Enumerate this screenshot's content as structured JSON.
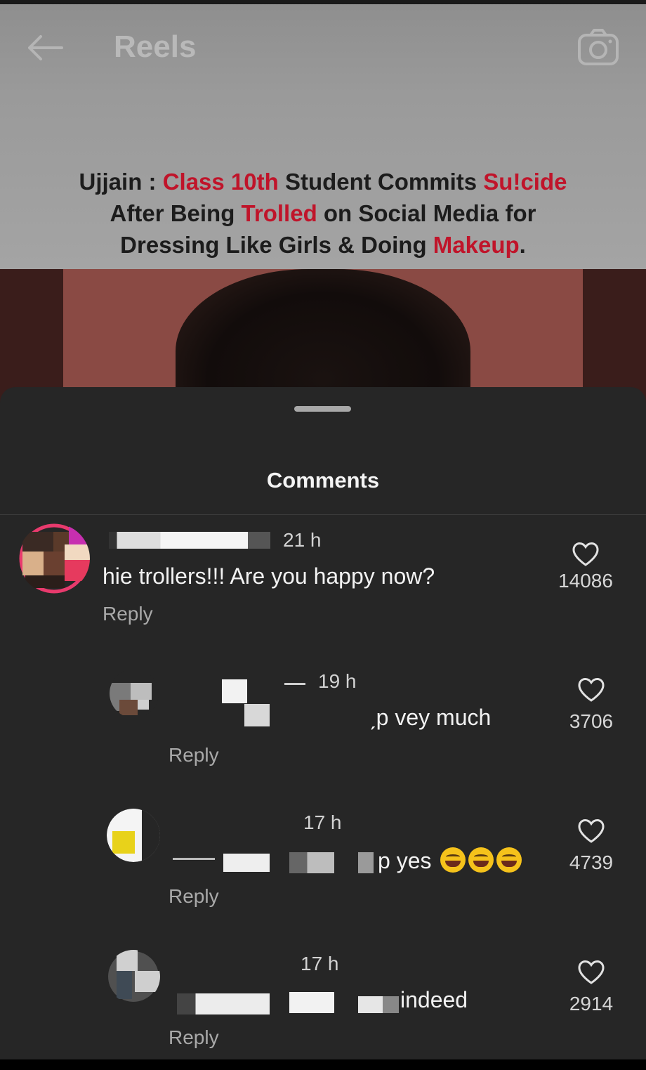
{
  "header": {
    "title": "Reels",
    "back_icon": "arrow-left-icon",
    "camera_icon": "camera-icon"
  },
  "headline": {
    "line1": [
      {
        "text": "Ujjain : ",
        "red": false
      },
      {
        "text": "Class 10th",
        "red": true
      },
      {
        "text": " Student Commits ",
        "red": false
      },
      {
        "text": "Su!cide",
        "red": true
      }
    ],
    "line2": [
      {
        "text": "After Being ",
        "red": false
      },
      {
        "text": "Trolled",
        "red": true
      },
      {
        "text": " on Social Media for",
        "red": false
      }
    ],
    "line3": [
      {
        "text": "Dressing Like Girls & Doing ",
        "red": false
      },
      {
        "text": "Makeup",
        "red": true
      },
      {
        "text": ".",
        "red": false
      }
    ]
  },
  "comments_sheet": {
    "title": "Comments",
    "comments": [
      {
        "time": "21 h",
        "text": "hie trollers!!! Are you happy now?",
        "reply_label": "Reply",
        "likes": "14086"
      },
      {
        "time": "19 h",
        "text": "ˏp vey much",
        "reply_label": "Reply",
        "likes": "3706"
      },
      {
        "time": "17 h",
        "text": "p yes",
        "emoji": "face-with-tears-of-joy",
        "emoji_count": 3,
        "reply_label": "Reply",
        "likes": "4739"
      },
      {
        "time": "17 h",
        "text": "indeed",
        "reply_label": "Reply",
        "likes": "2914"
      }
    ]
  },
  "colors": {
    "accent_red": "#c0142a",
    "sheet_bg": "#262626"
  }
}
